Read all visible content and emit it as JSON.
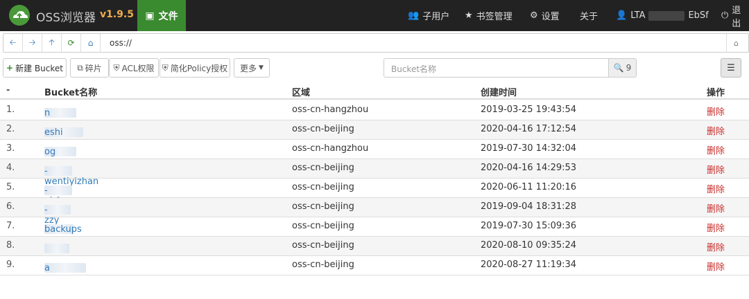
{
  "topbar": {
    "app_name": "OSS浏览器",
    "version": "v1.9.5",
    "files_tab": "文件",
    "sub_user": "子用户",
    "bookmarks": "书签管理",
    "settings": "设置",
    "about": "关于",
    "account": "LTA",
    "account_suffix": "EbSf",
    "logout": "退出"
  },
  "address": {
    "value": "oss://"
  },
  "toolbar": {
    "new_bucket": "新建 Bucket",
    "fragments": "碎片",
    "acl": "ACL权限",
    "policy": "简化Policy授权",
    "more": "更多",
    "search_placeholder": "Bucket名称",
    "search_count": "9"
  },
  "table": {
    "headers": {
      "idx": "-",
      "name": "Bucket名称",
      "region": "区域",
      "created": "创建时间",
      "action": "操作"
    },
    "rows": [
      {
        "idx": "1.",
        "name_pre": "ai",
        "name_post": "n",
        "region": "oss-cn-hangzhou",
        "created": "2019-03-25 19:43:54",
        "action": "删除"
      },
      {
        "idx": "2.",
        "name_pre": "a",
        "name_post": "eshi",
        "region": "oss-cn-beijing",
        "created": "2020-04-16 17:12:54",
        "action": "删除"
      },
      {
        "idx": "3.",
        "name_pre": "a",
        "name_post": "og",
        "region": "oss-cn-hangzhou",
        "created": "2019-07-30 14:32:04",
        "action": "删除"
      },
      {
        "idx": "4.",
        "name_pre": "ai",
        "name_post": "-wentiyizhan",
        "region": "oss-cn-beijing",
        "created": "2020-04-16 14:29:53",
        "action": "删除"
      },
      {
        "idx": "5.",
        "name_pre": "ai",
        "name_post": "-yizhan",
        "region": "oss-cn-beijing",
        "created": "2020-06-11 11:20:16",
        "action": "删除"
      },
      {
        "idx": "6.",
        "name_pre": "ai",
        "name_post": "-zzy",
        "region": "oss-cn-beijing",
        "created": "2019-09-04 18:31:28",
        "action": "删除"
      },
      {
        "idx": "7.",
        "name_pre": "a",
        "name_post": "backups",
        "region": "oss-cn-beijing",
        "created": "2019-07-30 15:09:36",
        "action": "删除"
      },
      {
        "idx": "8.",
        "name_pre": "x",
        "name_post": "",
        "region": "oss-cn-beijing",
        "created": "2020-08-10 09:35:24",
        "action": "删除"
      },
      {
        "idx": "9.",
        "name_pre": "x",
        "name_post": "a",
        "region": "oss-cn-beijing",
        "created": "2020-08-27 11:19:34",
        "action": "删除"
      }
    ]
  },
  "colors": {
    "topbar": "#222222",
    "files_tab": "#3a8a2f",
    "version": "#f0ad4e",
    "link": "#337ab7",
    "delete": "#c9302c"
  }
}
